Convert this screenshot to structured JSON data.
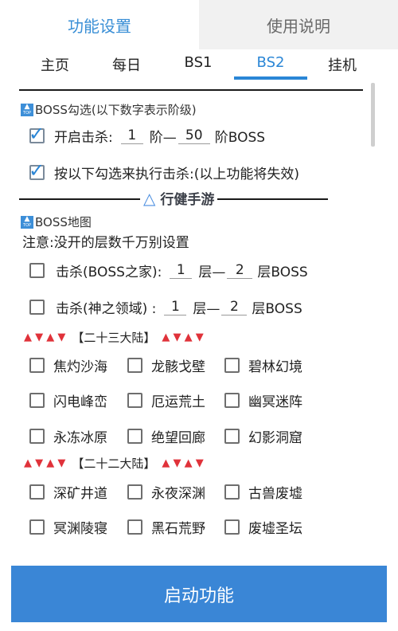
{
  "top_tabs": [
    {
      "label": "功能设置",
      "active": true
    },
    {
      "label": "使用说明",
      "active": false
    }
  ],
  "sub_tabs": [
    {
      "label": "主页"
    },
    {
      "label": "每日"
    },
    {
      "label": "BS1"
    },
    {
      "label": "BS2",
      "active": true
    },
    {
      "label": "挂机"
    }
  ],
  "boss_select": {
    "header": "BOSS勾选(以下数字表示阶级)",
    "kill_toggle": {
      "label": "开启击杀:",
      "checked": true,
      "from": "1",
      "sep": "阶—",
      "to": "50",
      "suffix": "阶BOSS"
    },
    "follow_checks": {
      "label": "按以下勾选来执行击杀:(以上功能将失效)",
      "checked": true
    }
  },
  "watermark": {
    "text": "行健手游",
    "icon": "triangle-logo-icon"
  },
  "boss_map": {
    "header": "BOSS地图",
    "note": "注意:没开的层数千万别设置",
    "rows": [
      {
        "label": "击杀(BOSS之家):",
        "from": "1",
        "sep": "层—",
        "to": "2",
        "suffix": "层BOSS",
        "checked": false
      },
      {
        "label": "击杀(神之领域) :",
        "from": "1",
        "sep": "层—",
        "to": "2",
        "suffix": "层BOSS",
        "checked": false
      }
    ]
  },
  "continents": [
    {
      "title": "【二十三大陆】",
      "tri_left": "▲ ▼ ▲ ▼",
      "tri_right": "▲ ▼ ▲ ▼",
      "maps": [
        "焦灼沙海",
        "龙骸戈壁",
        "碧林幻境",
        "闪电峰峦",
        "厄运荒土",
        "幽冥迷阵",
        "永冻冰原",
        "绝望回廊",
        "幻影洞窟"
      ]
    },
    {
      "title": "【二十二大陆】",
      "tri_left": "▲ ▼ ▲ ▼",
      "tri_right": "▲ ▼ ▲ ▼",
      "maps": [
        "深矿井道",
        "永夜深渊",
        "古兽废墟",
        "冥渊陵寝",
        "黑石荒野",
        "废墟圣坛"
      ]
    }
  ],
  "start_button": {
    "label": "启动功能"
  },
  "colors": {
    "accent": "#2a86d6",
    "button": "#3a86d6",
    "triangle": "#e0323a",
    "inactive_tab": "#f1f1f1"
  }
}
